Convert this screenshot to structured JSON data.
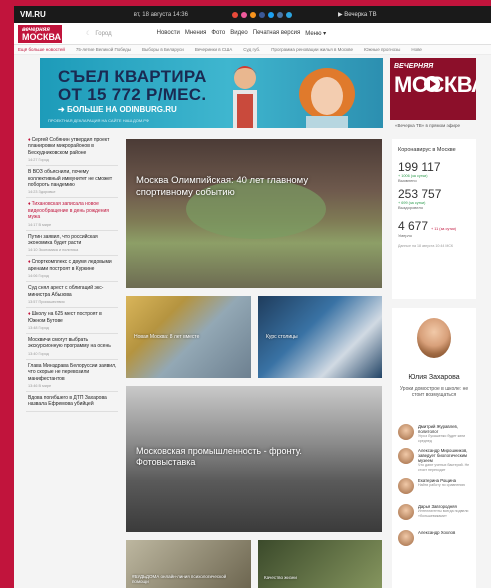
{
  "topbar": {
    "brand": "VM.RU",
    "date": "вт, 18 августа 14:36",
    "vtv": "Вечерка ТВ"
  },
  "header": {
    "logo_top": "вечерняя",
    "logo_bottom": "МОСКВА",
    "city": "Город",
    "nav": [
      "Новости",
      "Мнения",
      "Фото",
      "Видео",
      "Печатная версия",
      "Меню"
    ]
  },
  "tags": [
    "Ещё больше новостей",
    "75-летие Великой Победы",
    "Выборы в Беларуси",
    "Вечеринки в США",
    "Суд губ.",
    "Программа реновации жилья в Москве",
    "Южные прогнозы",
    "Нове"
  ],
  "banner": {
    "line1": "СЪЕЛ КВАРТИРА",
    "line2": "ОТ 15 772 Р/МЕС.",
    "line3": "БОЛЬШЕ НА ODINBURG.RU",
    "line4": "ПРОЕКТНАЯ ДЕКЛАРАЦИЯ НА САЙТЕ НАШ.ДОМ.РФ"
  },
  "vm_tv": {
    "top": "ВЕЧЕРНЯЯ",
    "bottom": "МОСКВА",
    "caption": "«Вечерка ТВ» в прямом эфире"
  },
  "news": [
    {
      "text": "Сергей Собянин утвердил проект планировки микрорайонов в Бескудниковском районе",
      "meta": "14:27   Город",
      "mark": true,
      "red": false
    },
    {
      "text": "В ВОЗ объяснили, почему коллективный иммунитет не сможет побороть пандемию",
      "meta": "14:23   Здоровье",
      "mark": false,
      "red": false
    },
    {
      "text": "Тихановская записала новое видеообращение в день рождения мужа",
      "meta": "14:17   В мире",
      "mark": true,
      "red": true
    },
    {
      "text": "Путин заявил, что российская экономика будет расти",
      "meta": "14:10   Экономика и политика",
      "mark": false,
      "red": false
    },
    {
      "text": "Спорткомплекс с двумя ледовыми аренами построят в Куркине",
      "meta": "14:06   Город",
      "mark": true,
      "red": false
    },
    {
      "text": "Суд снял арест с облигаций экс-министра Абызова",
      "meta": "13:57   Происшествия",
      "mark": false,
      "red": false
    },
    {
      "text": "Школу на 625 мест построят в Южном Бутове",
      "meta": "13:48   Город",
      "mark": true,
      "red": false
    },
    {
      "text": "Москвичи смогут выбрать экскурсионную программу на осень",
      "meta": "13:40   Город",
      "mark": false,
      "red": false
    },
    {
      "text": "Глава Минздрава Белоруссии заявил, что скорые не перевозили манифестантов",
      "meta": "13:46   В мире",
      "mark": false,
      "red": false
    },
    {
      "text": "Вдова погибшего в ДТП Захарова назвала Ефремова убийцей",
      "meta": "",
      "mark": false,
      "red": false
    }
  ],
  "main_story": {
    "caption": "Москва Олимпийская: 40 лет главному спортивному событию"
  },
  "tile_new_moscow": {
    "caption": "Новая Москва: 8 лет вместе"
  },
  "tile_capital": {
    "caption": "Курс столицы"
  },
  "bw_story": {
    "caption": "Московская промышленность - фронту. Фотовыставка"
  },
  "tile_dom": {
    "caption": "#БУДЬДОМА онлайн-линия психологической помощи"
  },
  "tile_quality": {
    "caption": "Качество жизни"
  },
  "covid": {
    "title": "Коронавирус в Москве",
    "cases": "199 117",
    "cases_delta": "+ 1006 (за сутки)",
    "cases_label": "Выявлено",
    "recovered": "253 757",
    "recovered_delta": "+ 699 (за сутки)",
    "recovered_label": "Выздоровело",
    "deaths": "4 677",
    "deaths_delta": "+ 11 (за сутки)",
    "deaths_label": "Умерло",
    "source": "Данные на 18 августа 10:44 МСК"
  },
  "author": {
    "name": "Юлия Захарова",
    "quote": "Уроки домострое в школе: не стоит возмущаться",
    "list": [
      {
        "name": "Дмитрий Журавлев, политолог",
        "desc": "Угроз Лукашенко будет кипи среднед"
      },
      {
        "name": "Александр Мирошников, заведует биологическим музеем",
        "desc": "Что дают ученых бактерий. Не стоит переходит"
      },
      {
        "name": "Екатерина Рощина",
        "desc": "Найти работу по сравнению"
      },
      {
        "name": "Дарья Завгородняя",
        "desc": "Интеллигенты всегда подвели «большевиками»"
      },
      {
        "name": "Александр Хохлов",
        "desc": ""
      }
    ]
  },
  "colors": {
    "brand_red": "#c1143c",
    "dark_red": "#8c0f2a",
    "banner_blue": "#2ea6c4"
  }
}
